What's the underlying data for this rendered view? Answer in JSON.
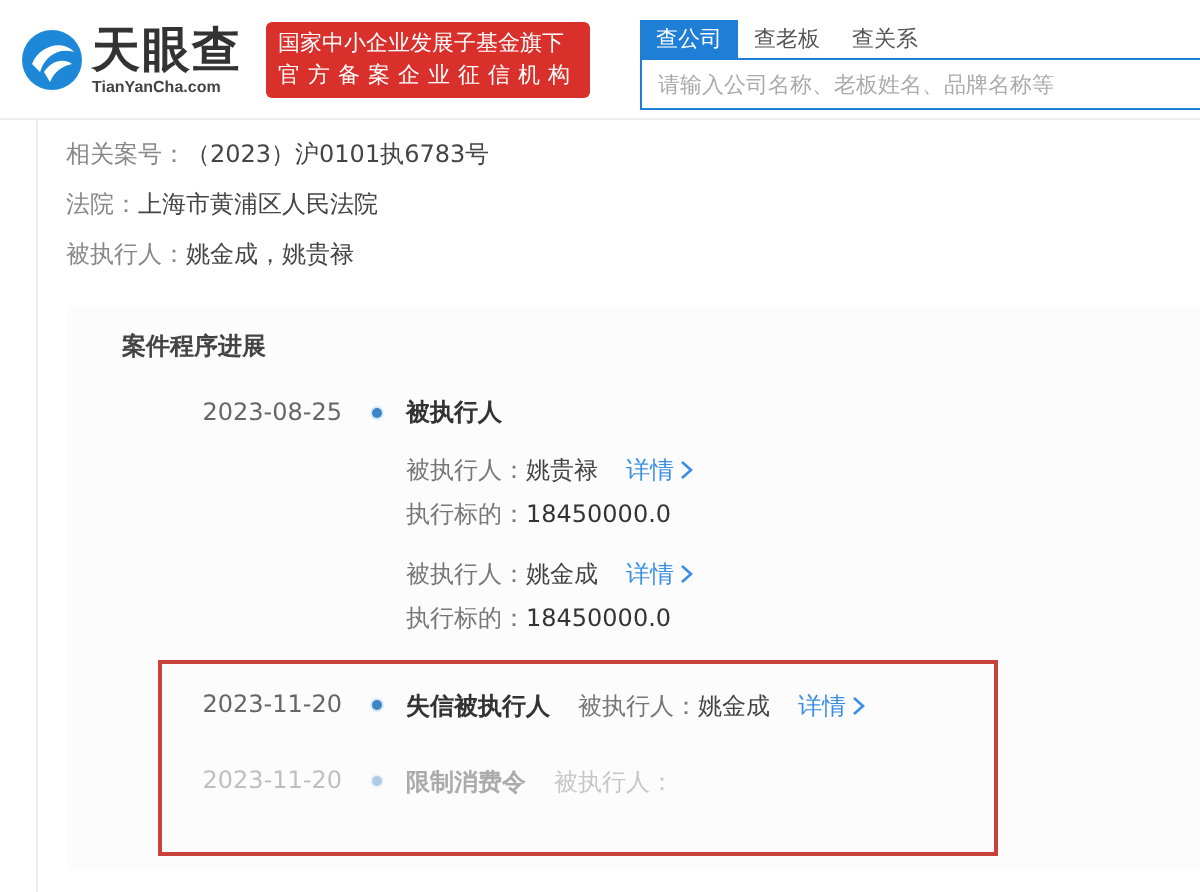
{
  "header": {
    "logo": {
      "name": "天眼查",
      "domain": "TianYanCha.com"
    },
    "badge_lines": [
      "国家中小企业发展子基金旗下",
      "官方备案企业征信机构"
    ],
    "search_tabs": [
      {
        "label": "查公司",
        "selected": true
      },
      {
        "label": "查老板",
        "selected": false
      },
      {
        "label": "查关系",
        "selected": false
      }
    ],
    "search": {
      "placeholder": "请输入公司名称、老板姓名、品牌名称等"
    }
  },
  "case_info": [
    {
      "label": "相关案号：",
      "value": "（2023）沪0101执6783号"
    },
    {
      "label": "法院：",
      "value": "上海市黄浦区人民法院"
    },
    {
      "label": "被执行人：",
      "value": "姚金成，姚贵禄"
    }
  ],
  "progress": {
    "title": "案件程序进展",
    "events": [
      {
        "date": "2023-08-25",
        "title": "被执行人",
        "highlighted": false,
        "faded": false,
        "kind": "stacked",
        "lines": [
          {
            "kind": "person",
            "label": "被执行人：",
            "value": "姚贵禄",
            "link": "详情"
          },
          {
            "kind": "amount",
            "label": "执行标的：",
            "value": "18450000.0"
          },
          {
            "kind": "person",
            "label": "被执行人：",
            "value": "姚金成",
            "link": "详情"
          },
          {
            "kind": "amount",
            "label": "执行标的：",
            "value": "18450000.0"
          }
        ]
      },
      {
        "date": "2023-11-20",
        "title": "失信被执行人",
        "highlighted": true,
        "faded": false,
        "kind": "inline",
        "lines": [
          {
            "kind": "person",
            "label": "被执行人：",
            "value": "姚金成",
            "link": "详情"
          }
        ]
      },
      {
        "date": "2023-11-20",
        "title": "限制消费令",
        "highlighted": true,
        "faded": true,
        "kind": "inline",
        "lines": [
          {
            "kind": "person",
            "label": "被执行人："
          }
        ]
      }
    ]
  }
}
